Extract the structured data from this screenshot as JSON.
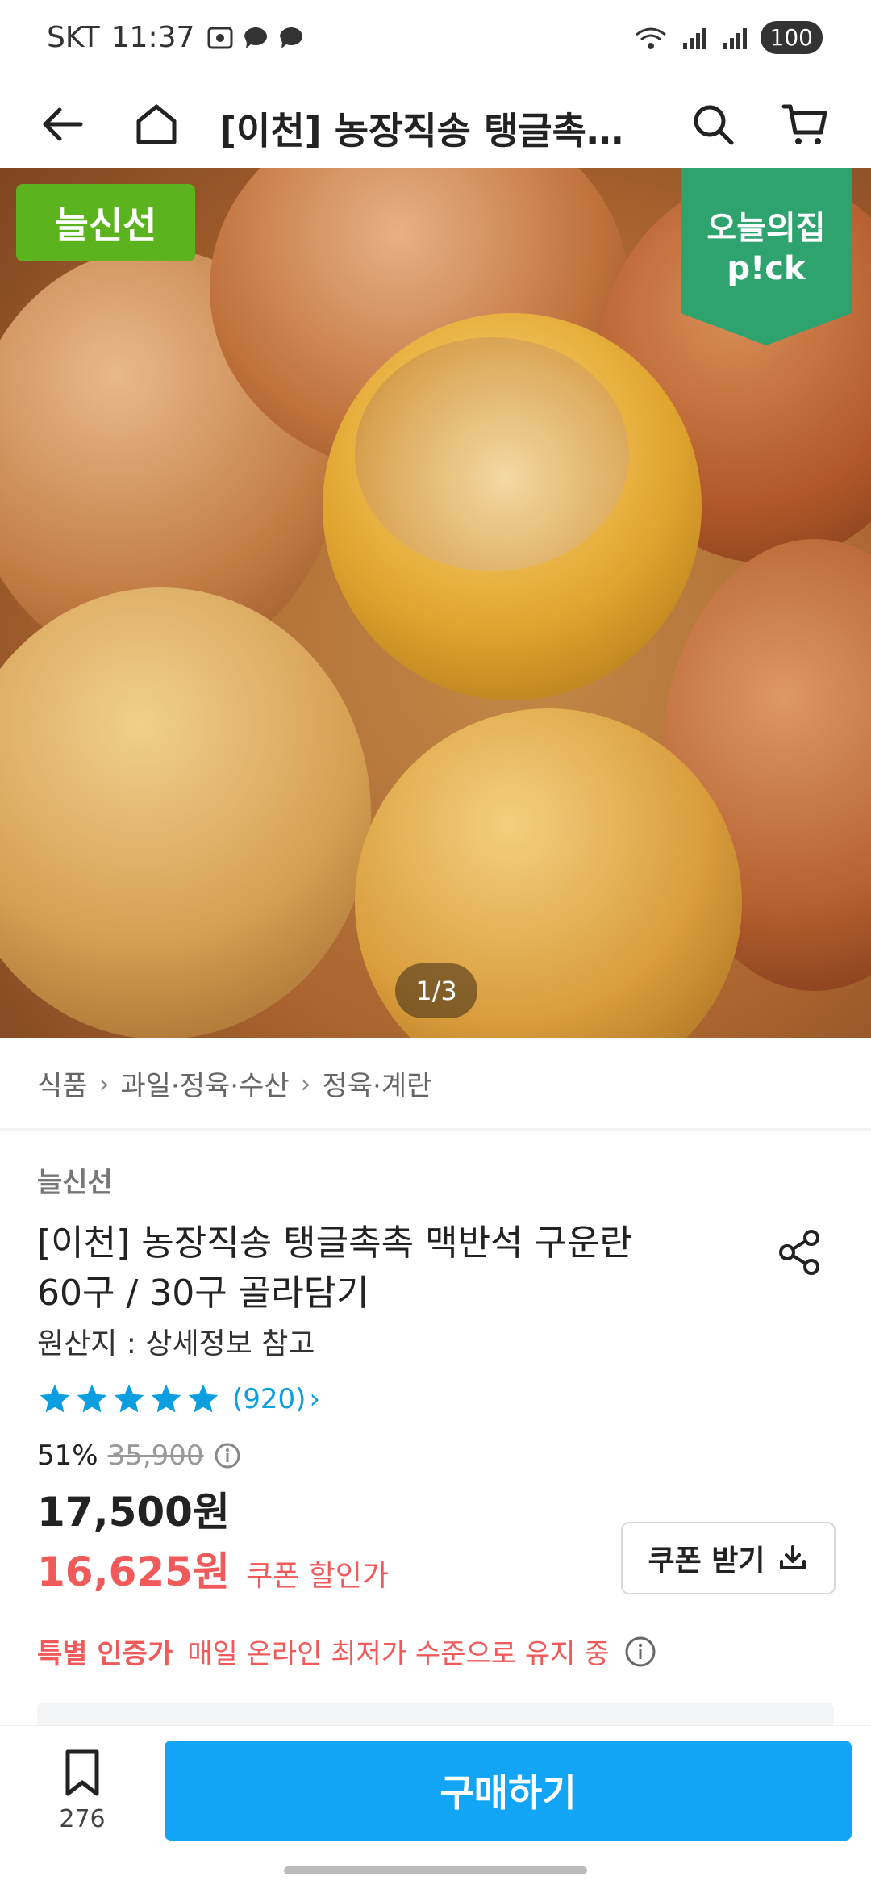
{
  "status": {
    "carrier": "SKT",
    "time": "11:37",
    "battery": "100"
  },
  "header": {
    "title": "[이천] 농장직송 탱글촉촉 맥…"
  },
  "hero": {
    "badge": "늘신선",
    "pick_line1": "오늘의집",
    "pick_line2": "p!ck",
    "pager": "1/3"
  },
  "breadcrumb": [
    "식품",
    "과일·정육·수산",
    "정육·계란"
  ],
  "product": {
    "brand": "늘신선",
    "title_line1": "[이천] 농장직송 탱글촉촉 맥반석 구운란",
    "title_line2": "60구 / 30구 골라담기",
    "origin": "원산지 : 상세정보 참고",
    "rating_stars": 5,
    "review_count": "(920)",
    "discount": "51%",
    "original_price": "35,900",
    "price": "17,500원",
    "coupon_price": "16,625원",
    "coupon_label": "쿠폰 할인가",
    "coupon_button": "쿠폰 받기",
    "special_label": "특별 인증가",
    "special_text": "매일 온라인 최저가 수준으로 유지 중"
  },
  "bottom": {
    "bookmark_count": "276",
    "buy_label": "구매하기"
  },
  "colors": {
    "accent": "#12a5f5",
    "sale": "#f05a5a",
    "star": "#0b9ee0",
    "badge_green": "#5bb31d",
    "pick_green": "#2fa36e"
  }
}
